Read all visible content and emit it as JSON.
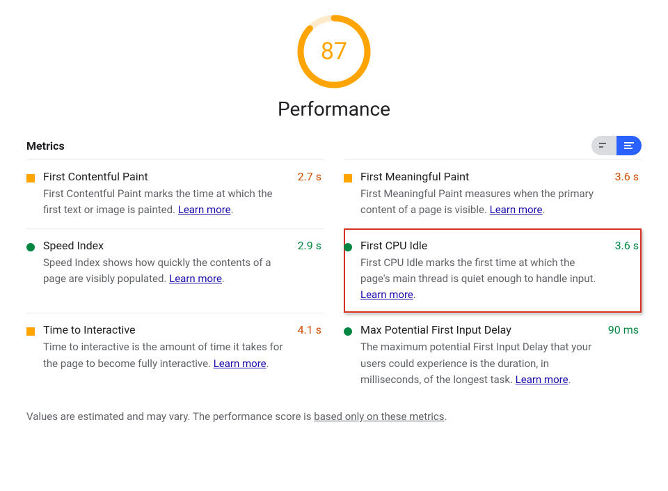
{
  "gauge": {
    "score": "87",
    "fraction": 0.87,
    "color": "#FFA400",
    "track": "#FFEBCC"
  },
  "category_title": "Performance",
  "metrics_heading": "Metrics",
  "learn_more": "Learn more",
  "metrics": [
    {
      "marker": "square",
      "title": "First Contentful Paint",
      "desc": "First Contentful Paint marks the time at which the first text or image is painted.",
      "value": "2.7 s",
      "rating": "avg"
    },
    {
      "marker": "square",
      "title": "First Meaningful Paint",
      "desc": "First Meaningful Paint measures when the primary content of a page is visible.",
      "value": "3.6 s",
      "rating": "avg"
    },
    {
      "marker": "circle",
      "title": "Speed Index",
      "desc": "Speed Index shows how quickly the contents of a page are visibly populated.",
      "value": "2.9 s",
      "rating": "good"
    },
    {
      "marker": "circle",
      "title": "First CPU Idle",
      "desc": "First CPU Idle marks the first time at which the page's main thread is quiet enough to handle input.",
      "value": "3.6 s",
      "rating": "good",
      "highlight": true
    },
    {
      "marker": "square",
      "title": "Time to Interactive",
      "desc": "Time to interactive is the amount of time it takes for the page to become fully interactive.",
      "value": "4.1 s",
      "rating": "avg"
    },
    {
      "marker": "circle",
      "title": "Max Potential First Input Delay",
      "desc": "The maximum potential First Input Delay that your users could experience is the duration, in milliseconds, of the longest task.",
      "value": "90 ms",
      "rating": "good"
    }
  ],
  "footnote": {
    "pre": "Values are estimated and may vary. The performance score is ",
    "link": "based only on these metrics",
    "post": "."
  }
}
